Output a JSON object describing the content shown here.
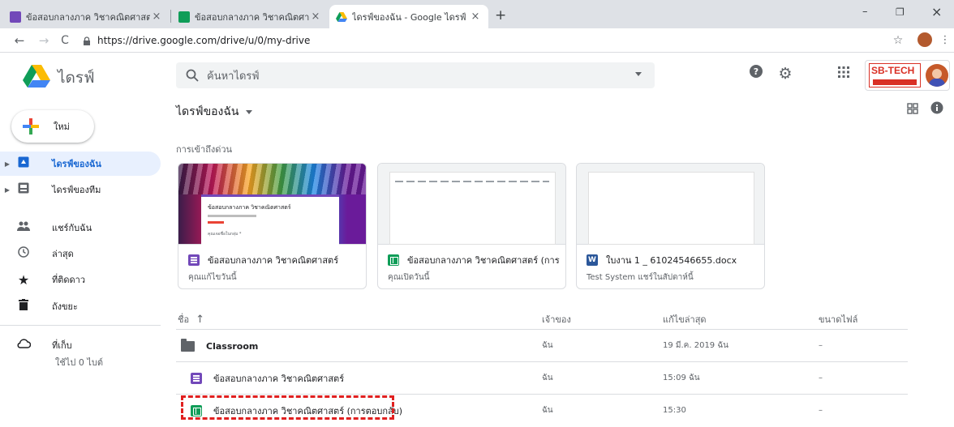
{
  "browser": {
    "tabs": [
      {
        "title": "ข้อสอบกลางภาค วิชาคณิตศาสตร์ - G",
        "icon": "forms-icon",
        "color": "#7248b9"
      },
      {
        "title": "ข้อสอบกลางภาค วิชาคณิตศาสตร์ (กา",
        "icon": "sheets-icon",
        "color": "#0f9d58"
      },
      {
        "title": "ไดรฟ์ของฉัน - Google ไดรฟ์",
        "icon": "drive-icon",
        "color": "#fbbc04"
      }
    ],
    "new_tab": "+",
    "close": "×",
    "window_controls": {
      "minimize": "–",
      "restore": "❐",
      "close": "×"
    },
    "url": "https://drive.google.com/drive/u/0/my-drive"
  },
  "header": {
    "app_name": "ไดรฟ์",
    "search_placeholder": "ค้นหาไดรฟ์",
    "brand_badge": "SB-TECH"
  },
  "sidebar": {
    "new_label": "ใหม่",
    "items": [
      {
        "label": "ไดรฟ์ของฉัน",
        "icon": "my-drive-icon",
        "selected": true
      },
      {
        "label": "ไดรฟ์ของทีม",
        "icon": "team-drive-icon",
        "selected": false
      },
      {
        "label": "แชร์กับฉัน",
        "icon": "shared-icon",
        "selected": false
      },
      {
        "label": "ล่าสุด",
        "icon": "clock-icon",
        "selected": false
      },
      {
        "label": "ที่ติดดาว",
        "icon": "star-icon",
        "selected": false
      },
      {
        "label": "ถังขยะ",
        "icon": "trash-icon",
        "selected": false
      }
    ],
    "storage_label": "ที่เก็บ",
    "storage_used": "ใช้ไป 0 ไบต์"
  },
  "main": {
    "title": "ไดรฟ์ของฉัน",
    "quick_access_label": "การเข้าถึงด่วน",
    "quick_access": [
      {
        "name": "ข้อสอบกลางภาค วิชาคณิตศาสตร์",
        "type": "form",
        "sub": "คุณแก้ไขวันนี้",
        "thumb_title": "ข้อสอบกลางภาค วิชาคณิตศาสตร์",
        "thumb_line": "คุณเจอชื่อในกลุ่ม *"
      },
      {
        "name": "ข้อสอบกลางภาค วิชาคณิตศาสตร์ (การต...",
        "type": "sheet",
        "sub": "คุณเปิดวันนี้"
      },
      {
        "name": "ใบงาน 1 _ 61024546655.docx",
        "type": "word",
        "sub": "Test System แชร์ในสัปดาห์นี้"
      }
    ],
    "columns": {
      "name": "ชื่อ",
      "sort_arrow": "↑",
      "owner": "เจ้าของ",
      "modified": "แก้ไขล่าสุด",
      "size": "ขนาดไฟล์"
    },
    "files": [
      {
        "name": "Classroom",
        "type": "folder",
        "owner": "ฉัน",
        "modified": "19 มี.ค. 2019 ฉัน",
        "size": "–"
      },
      {
        "name": "ข้อสอบกลางภาค วิชาคณิตศาสตร์",
        "type": "form",
        "owner": "ฉัน",
        "modified": "15:09 ฉัน",
        "size": "–"
      },
      {
        "name": "ข้อสอบกลางภาค วิชาคณิตศาสตร์ (การตอบกลับ)",
        "type": "sheet",
        "owner": "ฉัน",
        "modified": "15:30",
        "size": "–",
        "highlighted": true
      }
    ]
  }
}
